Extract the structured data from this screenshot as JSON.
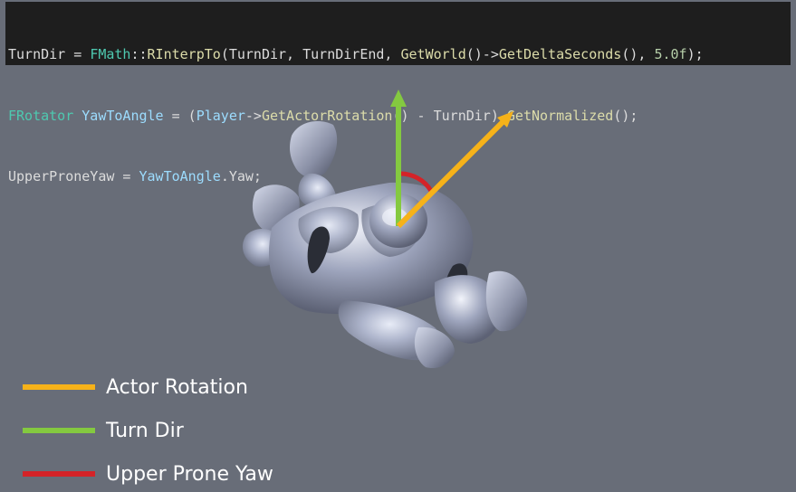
{
  "code": {
    "lines": [
      [
        {
          "t": "TurnDir = ",
          "c": "plain"
        },
        {
          "t": "FMath",
          "c": "type"
        },
        {
          "t": "::",
          "c": "plain"
        },
        {
          "t": "RInterpTo",
          "c": "func"
        },
        {
          "t": "(TurnDir, TurnDirEnd, ",
          "c": "plain"
        },
        {
          "t": "GetWorld",
          "c": "func"
        },
        {
          "t": "()->",
          "c": "plain"
        },
        {
          "t": "GetDeltaSeconds",
          "c": "func"
        },
        {
          "t": "(), ",
          "c": "plain"
        },
        {
          "t": "5.0f",
          "c": "num"
        },
        {
          "t": ");",
          "c": "plain"
        }
      ],
      [
        {
          "t": "FRotator",
          "c": "type"
        },
        {
          "t": " ",
          "c": "plain"
        },
        {
          "t": "YawToAngle",
          "c": "var"
        },
        {
          "t": " = (",
          "c": "plain"
        },
        {
          "t": "Player",
          "c": "var"
        },
        {
          "t": "->",
          "c": "plain"
        },
        {
          "t": "GetActorRotation",
          "c": "func"
        },
        {
          "t": "() - TurnDir).",
          "c": "plain"
        },
        {
          "t": "GetNormalized",
          "c": "func"
        },
        {
          "t": "();",
          "c": "plain"
        }
      ],
      [
        {
          "t": "UpperProneYaw = ",
          "c": "plain"
        },
        {
          "t": "YawToAngle",
          "c": "var"
        },
        {
          "t": ".Yaw;",
          "c": "plain"
        }
      ]
    ]
  },
  "colors": {
    "background": "#686d78",
    "actor_rotation": "#f6b219",
    "turn_dir": "#84c940",
    "upper_prone_yaw": "#d42328",
    "mannequin_base": "#b9bfd6",
    "code_bg": "#1e1e1e"
  },
  "legend": {
    "items": [
      {
        "label": "Actor Rotation",
        "color_key": "actor_rotation",
        "name": "legend-actor-rotation"
      },
      {
        "label": "Turn Dir",
        "color_key": "turn_dir",
        "name": "legend-turn-dir"
      },
      {
        "label": "Upper Prone Yaw",
        "color_key": "upper_prone_yaw",
        "name": "legend-upper-prone-yaw"
      }
    ]
  },
  "scene": {
    "subject": "prone-mannequin-top-view",
    "arrows": [
      "turn-dir-arrow",
      "actor-rotation-arrow"
    ],
    "arc": "upper-prone-yaw-arc"
  }
}
